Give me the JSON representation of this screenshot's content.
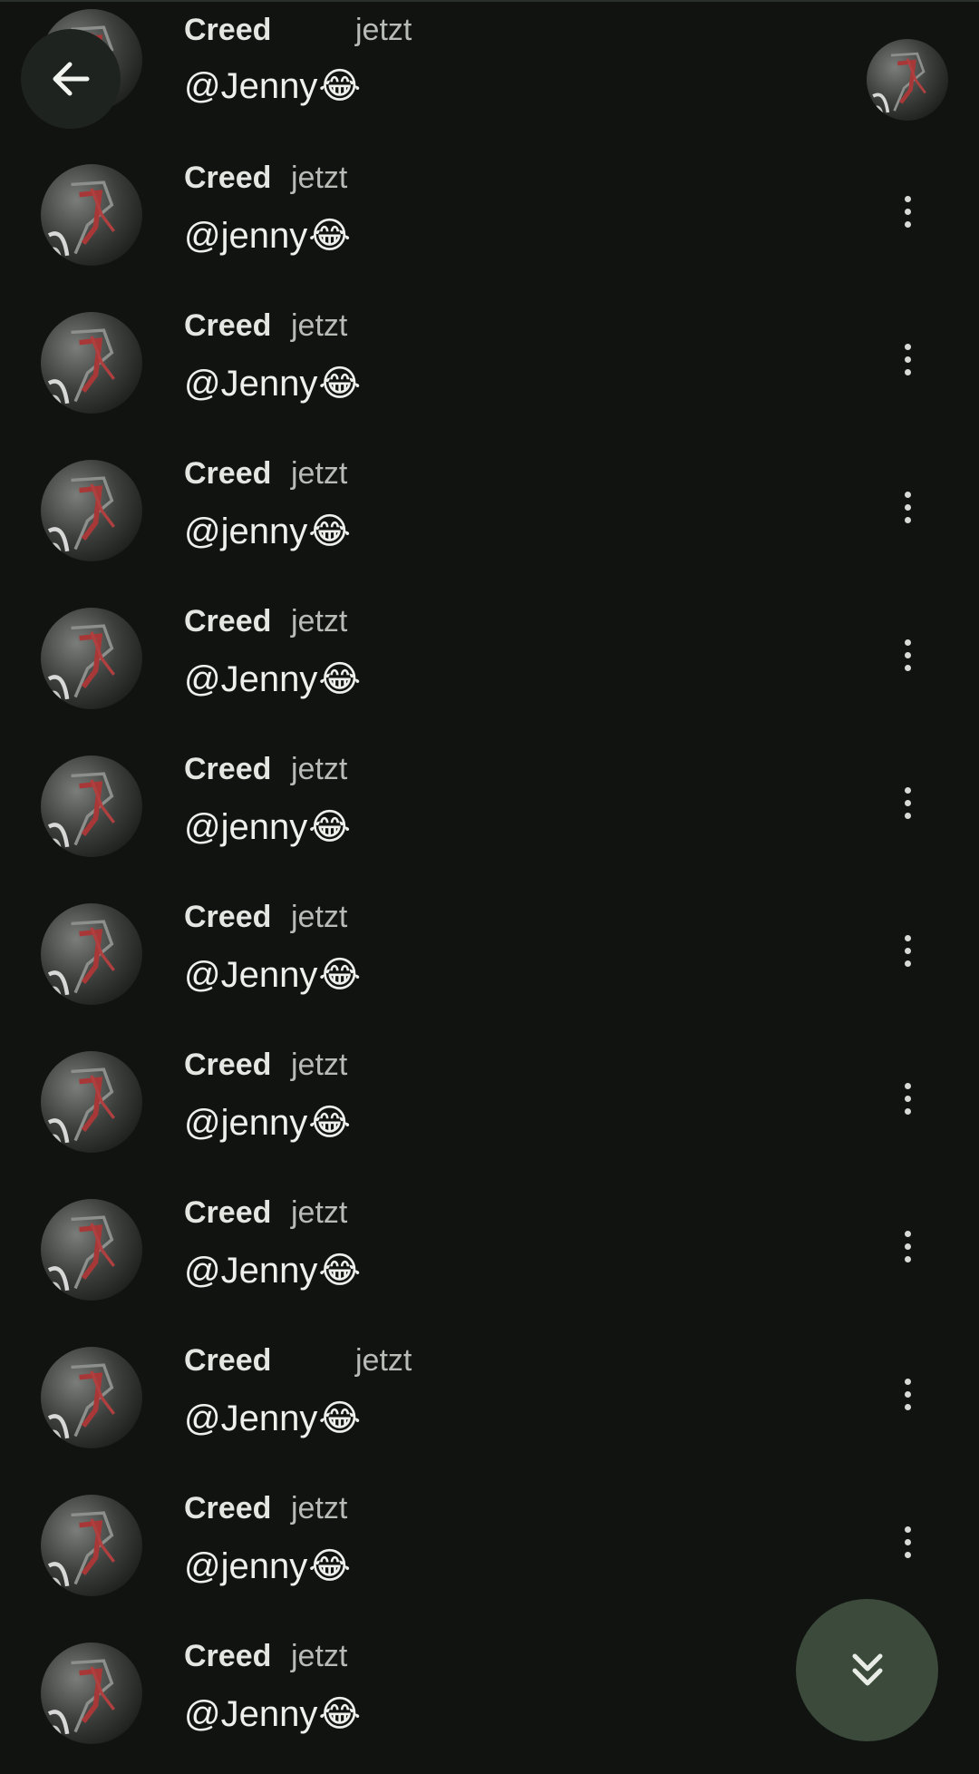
{
  "header": {
    "back_icon": "arrow-left-icon",
    "avatar_icon": "user-avatar"
  },
  "messages": [
    {
      "author": "Creed",
      "time": "jetzt",
      "text": "@Jenny",
      "emoji": "😂"
    },
    {
      "author": "Creed",
      "time": "jetzt",
      "text": "@jenny",
      "emoji": "😂"
    },
    {
      "author": "Creed",
      "time": "jetzt",
      "text": "@Jenny",
      "emoji": "😂"
    },
    {
      "author": "Creed",
      "time": "jetzt",
      "text": "@jenny",
      "emoji": "😂"
    },
    {
      "author": "Creed",
      "time": "jetzt",
      "text": "@Jenny",
      "emoji": "😂"
    },
    {
      "author": "Creed",
      "time": "jetzt",
      "text": "@jenny",
      "emoji": "😂"
    },
    {
      "author": "Creed",
      "time": "jetzt",
      "text": "@Jenny",
      "emoji": "😂"
    },
    {
      "author": "Creed",
      "time": "jetzt",
      "text": "@jenny",
      "emoji": "😂"
    },
    {
      "author": "Creed",
      "time": "jetzt",
      "text": "@Jenny",
      "emoji": "😂"
    },
    {
      "author": "Creed",
      "time": "jetzt",
      "text": "@Jenny",
      "emoji": "😂"
    },
    {
      "author": "Creed",
      "time": "jetzt",
      "text": "@jenny",
      "emoji": "😂"
    },
    {
      "author": "Creed",
      "time": "jetzt",
      "text": "@Jenny",
      "emoji": "😂"
    }
  ],
  "fab": {
    "icon": "double-chevron-down-icon"
  },
  "colors": {
    "background": "#111311",
    "fab": "#3b4a3b",
    "text": "#eef0ec",
    "muted": "#b8bcb6"
  }
}
